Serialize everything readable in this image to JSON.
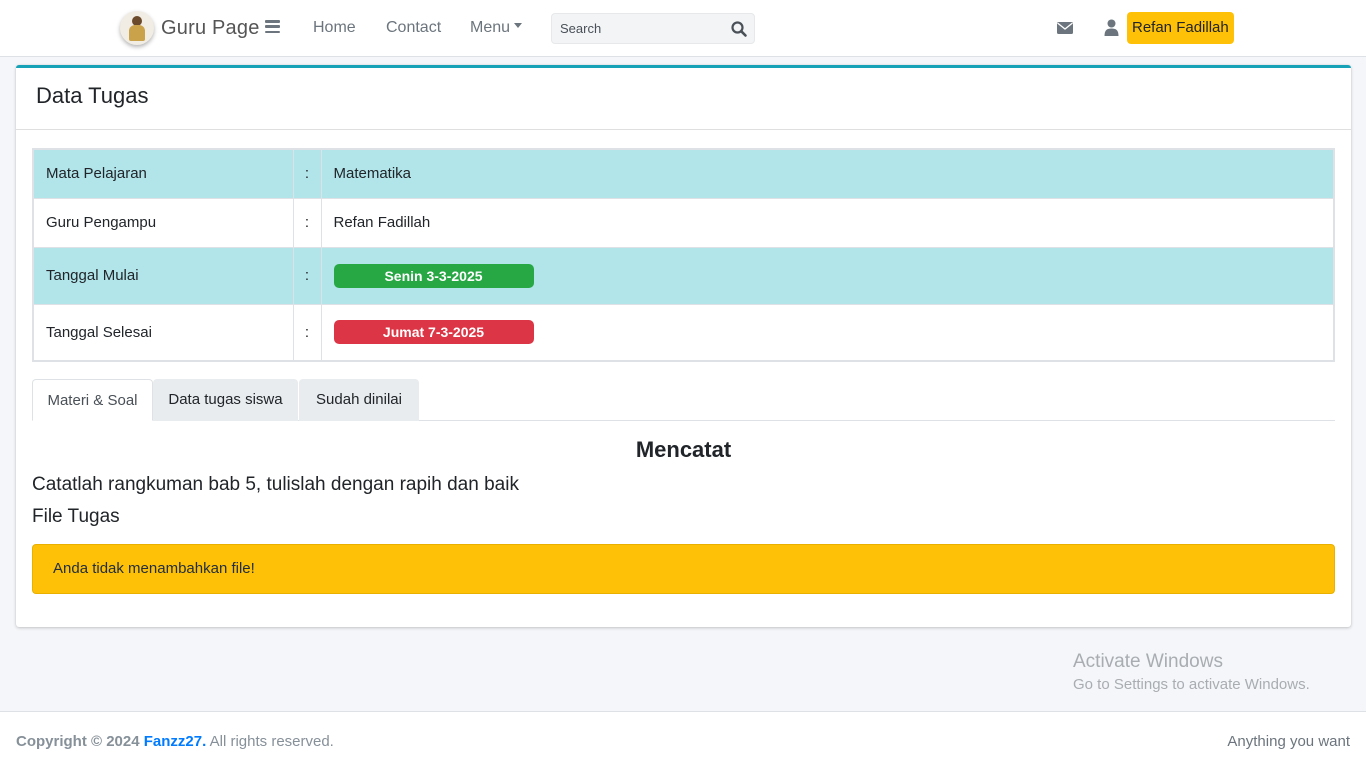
{
  "navbar": {
    "brand": "Guru Page",
    "links": {
      "home": "Home",
      "contact": "Contact",
      "menu": "Menu"
    },
    "search": {
      "placeholder": "Search",
      "value": ""
    },
    "user_name": "Refan Fadillah"
  },
  "card": {
    "title": "Data Tugas",
    "info": {
      "rows": [
        {
          "label": "Mata Pelajaran",
          "sep": ":",
          "value": "Matematika"
        },
        {
          "label": "Guru Pengampu",
          "sep": ":",
          "value": "Refan Fadillah"
        },
        {
          "label": "Tanggal Mulai",
          "sep": ":",
          "value": "Senin 3-3-2025"
        },
        {
          "label": "Tanggal Selesai",
          "sep": ":",
          "value": "Jumat 7-3-2025"
        }
      ]
    },
    "tabs": [
      "Materi & Soal",
      "Data tugas siswa",
      "Sudah dinilai"
    ],
    "active_tab": "Materi & Soal",
    "task": {
      "title": "Mencatat",
      "description": "Catatlah rangkuman bab 5, tulislah dengan rapih dan baik",
      "file_label": "File Tugas",
      "alert": "Anda tidak menambahkan file!"
    }
  },
  "watermark": {
    "title": "Activate Windows",
    "subtitle": "Go to Settings to activate Windows."
  },
  "footer": {
    "copyright": "Copyright © 2024",
    "author": "Fanzz27.",
    "rights": "All rights reserved.",
    "right_text": "Anything you want"
  },
  "colors": {
    "accent": "#17a2b8",
    "warning": "#ffc107",
    "success": "#28a745",
    "danger": "#dc3545",
    "row_highlight": "#b1e5ea"
  }
}
